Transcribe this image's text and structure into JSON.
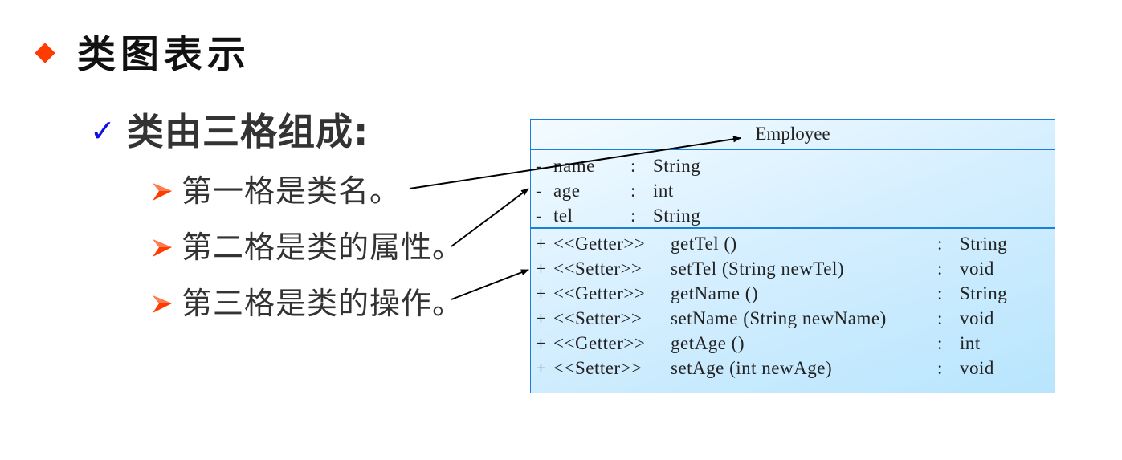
{
  "slide": {
    "title": "类图表示",
    "heading": "类由三格组成:",
    "items": [
      {
        "text": "第一格是类名。"
      },
      {
        "text": "第二格是类的属性。"
      },
      {
        "text": "第三格是类的操作。"
      }
    ],
    "colors": {
      "title_bullet": "#ff3b00",
      "check": "#1010e0",
      "arrow_bullet": "#ff3b00",
      "uml_border": "#1a7fd6"
    }
  },
  "uml_class": {
    "name": "Employee",
    "attributes": [
      {
        "visibility": "-",
        "name": "name",
        "type": "String"
      },
      {
        "visibility": "-",
        "name": "age",
        "type": "int"
      },
      {
        "visibility": "-",
        "name": "tel",
        "type": "String"
      }
    ],
    "operations": [
      {
        "visibility": "+",
        "stereotype": "<<Getter>>",
        "signature": "getTel ()",
        "return": "String"
      },
      {
        "visibility": "+",
        "stereotype": "<<Setter>>",
        "signature": "setTel (String newTel)",
        "return": "void"
      },
      {
        "visibility": "+",
        "stereotype": "<<Getter>>",
        "signature": "getName ()",
        "return": "String"
      },
      {
        "visibility": "+",
        "stereotype": "<<Setter>>",
        "signature": "setName (String newName)",
        "return": "void"
      },
      {
        "visibility": "+",
        "stereotype": "<<Getter>>",
        "signature": "getAge ()",
        "return": "int"
      },
      {
        "visibility": "+",
        "stereotype": "<<Setter>>",
        "signature": "setAge (int newAge)",
        "return": "void"
      }
    ]
  },
  "connectors": [
    {
      "from": "item-1",
      "to": "class-name"
    },
    {
      "from": "item-2",
      "to": "attributes"
    },
    {
      "from": "item-3",
      "to": "operations"
    }
  ]
}
